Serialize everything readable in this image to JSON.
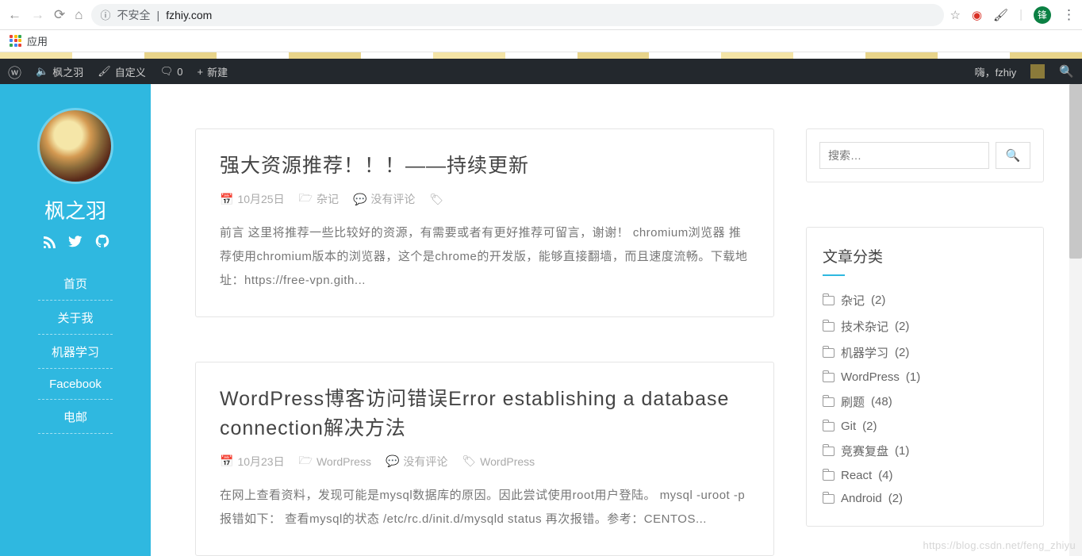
{
  "browser": {
    "security_label": "不安全",
    "url": "fzhiy.com",
    "apps_label": "应用"
  },
  "admin": {
    "site": "枫之羽",
    "customize": "自定义",
    "comments": "0",
    "new": "新建",
    "greeting": "嗨，fzhiy"
  },
  "sidebar": {
    "title": "枫之羽",
    "menu": [
      "首页",
      "关于我",
      "机器学习",
      "Facebook",
      "电邮"
    ]
  },
  "posts": [
    {
      "title": "强大资源推荐！！！——持续更新",
      "date": "10月25日",
      "category": "杂记",
      "comments": "没有评论",
      "excerpt": "前言 这里将推荐一些比较好的资源，有需要或者有更好推荐可留言，谢谢！ chromium浏览器 推荐使用chromium版本的浏览器，这个是chrome的开发版，能够直接翻墙，而且速度流畅。下载地址：https://free-vpn.gith..."
    },
    {
      "title": "WordPress博客访问错误Error establishing a database connection解决方法",
      "date": "10月23日",
      "category": "WordPress",
      "comments": "没有评论",
      "tag": "WordPress",
      "excerpt": "在网上查看资料，发现可能是mysql数据库的原因。因此尝试使用root用户登陆。 mysql -uroot -p 报错如下：  查看mysql的状态 /etc/rc.d/init.d/mysqld status  再次报错。参考：CENTOS..."
    }
  ],
  "search": {
    "placeholder": "搜索…"
  },
  "widget": {
    "title": "文章分类",
    "cats": [
      {
        "name": "杂记",
        "count": "(2)"
      },
      {
        "name": "技术杂记",
        "count": "(2)"
      },
      {
        "name": "机器学习",
        "count": "(2)"
      },
      {
        "name": "WordPress",
        "count": "(1)"
      },
      {
        "name": "刷题",
        "count": "(48)"
      },
      {
        "name": "Git",
        "count": "(2)"
      },
      {
        "name": "竞赛复盘",
        "count": "(1)"
      },
      {
        "name": "React",
        "count": "(4)"
      },
      {
        "name": "Android",
        "count": "(2)"
      }
    ]
  },
  "watermark": "https://blog.csdn.net/feng_zhiyu"
}
